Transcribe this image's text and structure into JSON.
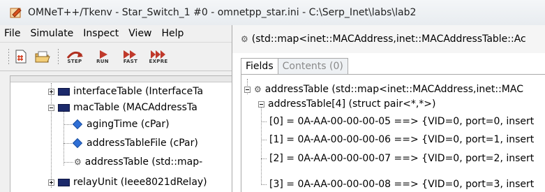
{
  "window": {
    "title": "OMNeT++/Tkenv - Star_Switch_1 #0 - omnetpp_star.ini - C:\\Serp_Inet\\labs\\lab2"
  },
  "menu": [
    "File",
    "Simulate",
    "Inspect",
    "View",
    "Help"
  ],
  "toolbar": {
    "step_label": "STEP",
    "run_label": "RUN",
    "fast_label": "FAST",
    "express_label": "EXPRE"
  },
  "object_tree": {
    "items": [
      {
        "label": "interfaceTable (InterfaceTa",
        "type": "module",
        "expander": "plus"
      },
      {
        "label": "macTable (MACAddressTa",
        "type": "module",
        "expander": "minus"
      },
      {
        "label": "agingTime (cPar)",
        "type": "parameter"
      },
      {
        "label": "addressTableFile (cPar)",
        "type": "parameter"
      },
      {
        "label": "addressTable (std::map-",
        "type": "map"
      },
      {
        "label": "relayUnit (Ieee8021dRelay)",
        "type": "module",
        "expander": "plus"
      }
    ]
  },
  "inspector": {
    "header": "(std::map<inet::MACAddress,inet::MACAddressTable::Ac",
    "tabs": [
      "Fields",
      "Contents (0)"
    ],
    "active_tab": "Fields",
    "tree": {
      "root": "addressTable (std::map<inet::MACAddress,inet::MAC",
      "child": "addressTable[4] (struct pair<*,*>)",
      "entries": [
        "[0] = 0A-AA-00-00-00-05 ==> {VID=0, port=0, insert",
        "[1] = 0A-AA-00-00-00-06 ==> {VID=0, port=1, insert",
        "[2] = 0A-AA-00-00-00-07 ==> {VID=0, port=2, insert",
        "[3] = 0A-AA-00-00-00-08 ==> {VID=0, port=3, insert"
      ]
    }
  },
  "icons": [
    "app-icon",
    "new-document-icon",
    "open-folder-icon",
    "step-icon",
    "run-icon",
    "fast-icon",
    "express-icon",
    "module-icon",
    "parameter-icon",
    "map-icon"
  ],
  "colors": {
    "module_icon": "#1c2a6b",
    "parameter_icon": "#2f6fd6",
    "run_arrow": "#c0392b"
  }
}
